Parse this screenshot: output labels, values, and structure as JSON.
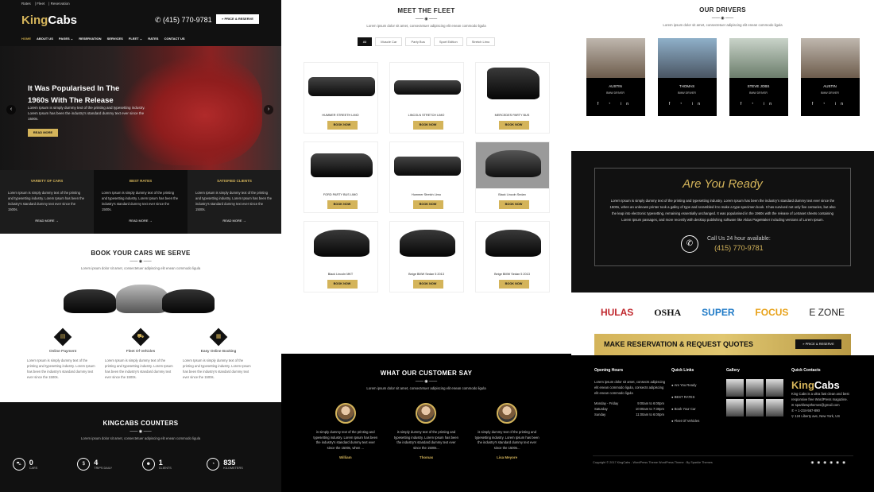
{
  "col1": {
    "topbar": [
      "Rates",
      "Fleet",
      "Reservation"
    ],
    "logo": {
      "a": "King",
      "b": "Cabs"
    },
    "phone": "(415) 770-9781",
    "price_btn": "» PRICE & RESERVE",
    "nav": [
      "HOME",
      "ABOUT US",
      "PAGES ⌄",
      "RESERVATION",
      "SERVICES",
      "FLEET ⌄",
      "RATES",
      "CONTACT US"
    ],
    "hero": {
      "title": "It Was Popularised In The 1960s With The Release",
      "text": "Lorem Ipsum is simply dummy text of the printing and typesetting industry. Lorem Ipsum has been the industry's standard dummy text ever since the 1500s.",
      "button": "READ MORE"
    },
    "features": [
      {
        "title": "VARIETY OF CARS",
        "text": "Lorem Ipsum is simply dummy text of the printing and typesetting industry. Lorem Ipsum has been the industry's standard dummy text ever since the 1500s.",
        "more": "READ MORE →"
      },
      {
        "title": "BEST RATES",
        "text": "Lorem Ipsum is simply dummy text of the printing and typesetting industry. Lorem Ipsum has been the industry's standard dummy text ever since the 1500s.",
        "more": "READ MORE →"
      },
      {
        "title": "SATISFIED CLIENTS",
        "text": "Lorem Ipsum is simply dummy text of the printing and typesetting industry. Lorem Ipsum has been the industry's standard dummy text ever since the 1500s.",
        "more": "READ MORE →"
      }
    ],
    "book": {
      "title": "BOOK YOUR CARS WE SERVE",
      "sub": "Lorem ipsum dolor sit amet, consectetuer adipiscing elit enean commodo ligula",
      "services": [
        {
          "title": "Online Payment",
          "text": "Lorem Ipsum is simply dummy text of the printing and typesetting industry. Lorem Ipsum has been the industry's standard dummy text ever since the 1500s."
        },
        {
          "title": "Fleet Of Vehicles",
          "text": "Lorem Ipsum is simply dummy text of the printing and typesetting industry. Lorem Ipsum has been the industry's standard dummy text ever since the 1500s."
        },
        {
          "title": "Easy Online Booking",
          "text": "Lorem Ipsum is simply dummy text of the printing and typesetting industry. Lorem Ipsum has been the industry's standard dummy text ever since the 1500s."
        }
      ]
    },
    "counters": {
      "title": "KINGCABS COUNTERS",
      "sub": "Lorem ipsum dolor sit amet, consectetuer adipiscing elit enean commodo ligula",
      "items": [
        {
          "num": "0",
          "label": "CARS"
        },
        {
          "num": "4",
          "label": "TRIPS DAILY"
        },
        {
          "num": "1",
          "label": "CLIENTS"
        },
        {
          "num": "835",
          "label": "KILOMETERS"
        }
      ]
    }
  },
  "col2": {
    "fleet": {
      "title": "MEET THE FLEET",
      "sub": "Lorem ipsum dolor sit amet, consectetuer adipiscing elit enean commodo ligula",
      "tabs": [
        "All",
        "Muscle Car",
        "Party Bus",
        "Sport Edition",
        "Stretch Limo"
      ],
      "cars": [
        {
          "name": "HUMMER STREETH LIMO",
          "btn": "BOOK NOW"
        },
        {
          "name": "LINCOLN STRETCH LIMO",
          "btn": "BOOK NOW"
        },
        {
          "name": "MERCEDES PARTY BUS",
          "btn": "BOOK NOW"
        },
        {
          "name": "FORD PARTY BUS LIMO",
          "btn": "BOOK NOW"
        },
        {
          "name": "Hummer Stretch Limo",
          "btn": "BOOK NOW"
        },
        {
          "name": "Black Lincoln Sedan",
          "btn": "BOOK NOW"
        },
        {
          "name": "Black Lincoln MKT",
          "btn": "BOOK NOW"
        },
        {
          "name": "Beige BMW Sedan 5 2013",
          "btn": "BOOK NOW"
        },
        {
          "name": "Beige BMW Sedan 5 2013",
          "btn": "BOOK NOW"
        }
      ]
    },
    "testimonials": {
      "title": "WHAT OUR CUSTOMER SAY",
      "sub": "Lorem ipsum dolor sit amet, consectetuer adipiscing elit enean commodo ligula",
      "items": [
        {
          "text": "is simply dummy text of the printing and typesetting industry. Lorem Ipsum has been the industry's standard dummy text ever since the 1500s, when ...",
          "name": "William"
        },
        {
          "text": "is simply dummy text of the printing and typesetting industry. Lorem Ipsum has been the industry's standard dummy text ever since the 1500s...",
          "name": "Thomas"
        },
        {
          "text": "is simply dummy text of the printing and typesetting industry. Lorem Ipsum has been the industry's standard dummy text ever since the 1500s...",
          "name": "Lisa Meyore"
        }
      ]
    }
  },
  "col3": {
    "drivers": {
      "title": "OUR DRIVERS",
      "sub": "Lorem ipsum dolor sit amet, consectetuer adipiscing elit enean commodo ligula",
      "items": [
        {
          "name": "AUSTIN",
          "role": "BMW DRIVER"
        },
        {
          "name": "THOMAS",
          "role": "BMW DRIVER"
        },
        {
          "name": "STEVE JOBS",
          "role": "BMW DRIVER"
        },
        {
          "name": "AUSTIN",
          "role": "BMW DRIVER"
        }
      ],
      "social": "f  ᵗ  in"
    },
    "ready": {
      "title": "Are You Ready",
      "text": "Lorem Ipsum is simply dummy text of the printing and typesetting industry. Lorem Ipsum has been the industry's standard dummy text ever since the 1500s, when an unknown printer took a galley of type and scrambled it to make a type specimen book. It has survived not only five centuries, but also the leap into electronic typesetting, remaining essentially unchanged. It was popularised in the 1960s with the release of Letraset sheets containing Lorem Ipsum passages, and more recently with desktop publishing software like Aldus PageMaker including versions of Lorem Ipsum.",
      "call_label": "Call Us 24 hour available:",
      "call_phone": "(415) 770-9781"
    },
    "brands": [
      "HULAS",
      "OSHA",
      "SUPER",
      "FOCUS",
      "E ZONE"
    ],
    "reserve": {
      "text": "MAKE RESERVATION & REQUEST QUOTES",
      "btn": "» PRICE & RESERVE"
    },
    "footer": {
      "hours_title": "Opening Hours",
      "hours_text": "Lorem ipsum dolor sit amet, consects adipiscing elit enean commodo ligula, consects adipiscing elit enean commodo ligula",
      "hours": [
        {
          "d": "Monday - Friday",
          "t": "9:00am to 6:00pm"
        },
        {
          "d": "Saturday",
          "t": "10:00am to 7:30pm"
        },
        {
          "d": "Sunday",
          "t": "11:00am to 6:00pm"
        }
      ],
      "links_title": "Quick Links",
      "links": [
        "Are You Ready",
        "BEST RATES",
        "Book Your Car",
        "Fleet Of Vehicles"
      ],
      "gallery_title": "Gallery",
      "contacts_title": "Quick Contacts",
      "logo": {
        "a": "King",
        "b": "Cabs"
      },
      "about": "King Cabs is a ultra fast clean and best responsive free WordPress magazine.",
      "email": "sparklewpthemes@gmail.com",
      "tel": "+ 1-234-567-890",
      "address": "124 Liberty ave, New York, US",
      "copyright": "Copyright © 2017 KingCabs - WordPress Theme WordPress Theme : By Sparkle Themes"
    }
  }
}
